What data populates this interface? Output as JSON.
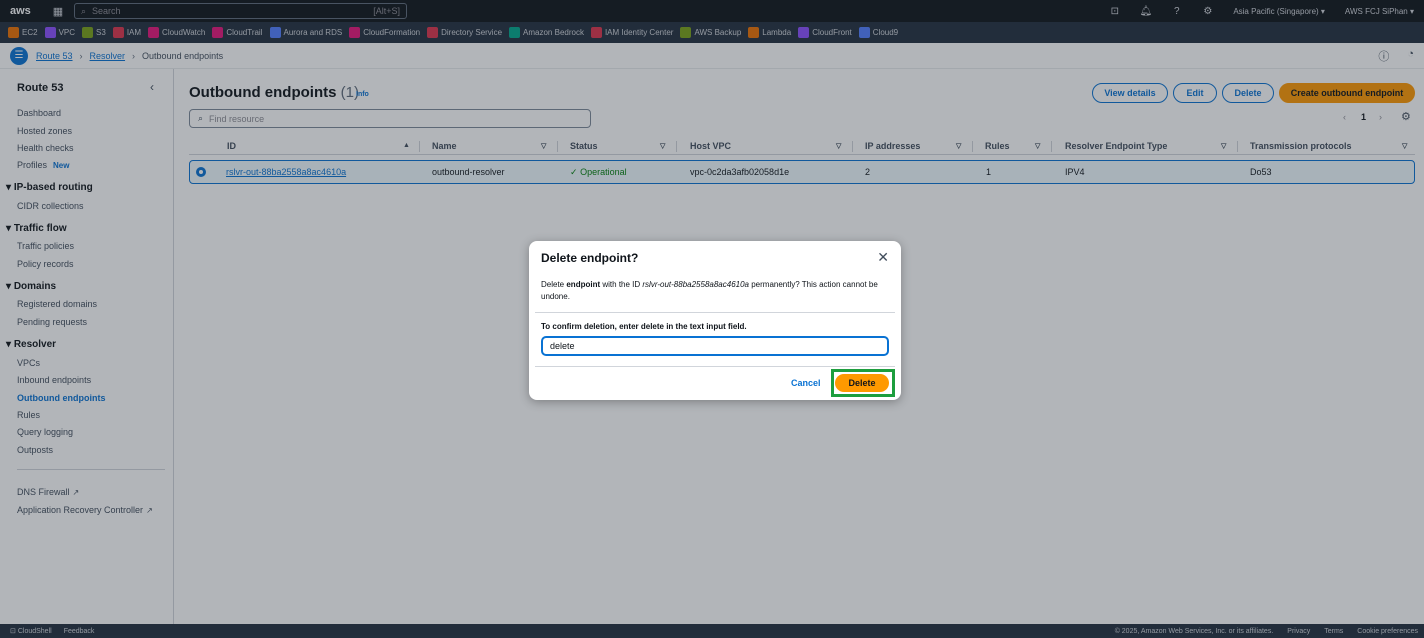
{
  "topbar": {
    "logo": "aws",
    "search_placeholder": "Search",
    "search_shortcut": "[Alt+S]",
    "region": "Asia Pacific (Singapore) ▾",
    "account": "AWS FCJ SiPhan ▾"
  },
  "favorites": [
    {
      "label": "EC2",
      "color": "#ed7100"
    },
    {
      "label": "VPC",
      "color": "#8c4fff"
    },
    {
      "label": "S3",
      "color": "#7aa116"
    },
    {
      "label": "IAM",
      "color": "#dd344c"
    },
    {
      "label": "CloudWatch",
      "color": "#e7157b"
    },
    {
      "label": "CloudTrail",
      "color": "#e7157b"
    },
    {
      "label": "Aurora and RDS",
      "color": "#527fff"
    },
    {
      "label": "CloudFormation",
      "color": "#e7157b"
    },
    {
      "label": "Directory Service",
      "color": "#dd344c"
    },
    {
      "label": "Amazon Bedrock",
      "color": "#01a88d"
    },
    {
      "label": "IAM Identity Center",
      "color": "#dd344c"
    },
    {
      "label": "AWS Backup",
      "color": "#7aa116"
    },
    {
      "label": "Lambda",
      "color": "#ed7100"
    },
    {
      "label": "CloudFront",
      "color": "#8c4fff"
    },
    {
      "label": "Cloud9",
      "color": "#527fff"
    }
  ],
  "breadcrumb": {
    "item1": "Route 53",
    "item2": "Resolver",
    "current": "Outbound endpoints"
  },
  "sidebar": {
    "title": "Route 53",
    "items": {
      "dashboard": "Dashboard",
      "hosted_zones": "Hosted zones",
      "health_checks": "Health checks",
      "profiles": "Profiles",
      "profiles_badge": "New",
      "ip_routing": "IP-based routing",
      "cidr": "CIDR collections",
      "traffic_flow": "Traffic flow",
      "traffic_policies": "Traffic policies",
      "policy_records": "Policy records",
      "domains": "Domains",
      "registered_domains": "Registered domains",
      "pending_requests": "Pending requests",
      "resolver": "Resolver",
      "vpcs": "VPCs",
      "inbound": "Inbound endpoints",
      "outbound": "Outbound endpoints",
      "rules": "Rules",
      "query_logging": "Query logging",
      "outposts": "Outposts",
      "dns_firewall": "DNS Firewall",
      "arc": "Application Recovery Controller"
    }
  },
  "main": {
    "title": "Outbound endpoints",
    "count": "(1)",
    "info": "Info",
    "buttons": {
      "view_details": "View details",
      "edit": "Edit",
      "delete": "Delete",
      "create": "Create outbound endpoint"
    },
    "find_placeholder": "Find resource",
    "page": "1",
    "columns": [
      "ID",
      "Name",
      "Status",
      "Host VPC",
      "IP addresses",
      "Rules",
      "Resolver Endpoint Type",
      "Transmission protocols"
    ],
    "row": {
      "id": "rslvr-out-88ba2558a8ac4610a",
      "name": "outbound-resolver",
      "status": "Operational",
      "vpc": "vpc-0c2da3afb02058d1e",
      "ips": "2",
      "rules": "1",
      "type": "IPV4",
      "protocols": "Do53"
    }
  },
  "footer": {
    "cloudshell": "CloudShell",
    "feedback": "Feedback",
    "copyright": "© 2025, Amazon Web Services, Inc. or its affiliates.",
    "privacy": "Privacy",
    "terms": "Terms",
    "cookies": "Cookie preferences"
  },
  "modal": {
    "title": "Delete endpoint?",
    "body_pre": "Delete ",
    "body_bold": "endpoint",
    "body_mid": " with the ID ",
    "body_id": "rslvr-out-88ba2558a8ac4610a",
    "body_post": " permanently? This action cannot be undone.",
    "confirm_label": "To confirm deletion, enter delete in the text input field.",
    "input_value": "delete",
    "cancel": "Cancel",
    "delete": "Delete"
  }
}
